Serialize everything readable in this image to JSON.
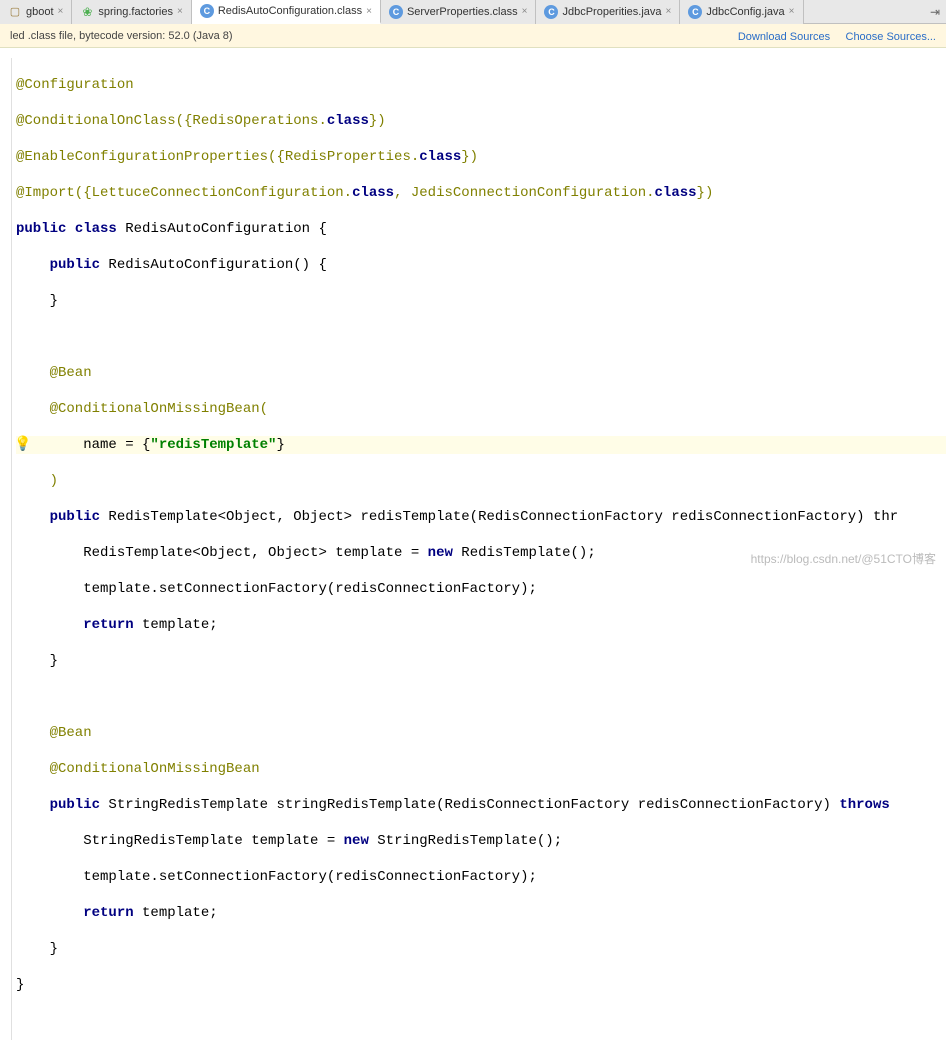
{
  "tabs": [
    {
      "label": "gboot",
      "type": "box"
    },
    {
      "label": "spring.factories",
      "type": "leaf"
    },
    {
      "label": "RedisAutoConfiguration.class",
      "type": "c",
      "active": true
    },
    {
      "label": "ServerProperties.class",
      "type": "c"
    },
    {
      "label": "JdbcProperities.java",
      "type": "c"
    },
    {
      "label": "JdbcConfig.java",
      "type": "c"
    }
  ],
  "info_bar": {
    "text": "led .class file, bytecode version: 52.0 (Java 8)",
    "download": "Download Sources",
    "choose": "Choose Sources..."
  },
  "code": {
    "l1": "@Configuration",
    "l2_a": "@ConditionalOnClass({RedisOperations.",
    "l2_b": "class",
    "l2_c": "})",
    "l3_a": "@EnableConfigurationProperties({RedisProperties.",
    "l3_b": "class",
    "l3_c": "})",
    "l4_a": "@Import({LettuceConnectionConfiguration.",
    "l4_b": "class",
    "l4_c": ", JedisConnectionConfiguration.",
    "l4_d": "class",
    "l4_e": "})",
    "l5_a": "public",
    "l5_b": " class",
    "l5_c": " RedisAutoConfiguration {",
    "l6_a": "    public",
    "l6_b": " RedisAutoConfiguration() {",
    "l7": "    }",
    "l8": "    @Bean",
    "l9": "    @ConditionalOnMissingBean(",
    "l10_a": "        name = {",
    "l10_b": "\"redisTemplate\"",
    "l10_c": "}",
    "l11": "    )",
    "l12_a": "    public",
    "l12_b": " RedisTemplate<Object, Object> redisTemplate(RedisConnectionFactory redisConnectionFactory) thr",
    "l13_a": "        RedisTemplate<Object, Object> template = ",
    "l13_b": "new",
    "l13_c": " RedisTemplate();",
    "l14": "        template.setConnectionFactory(redisConnectionFactory);",
    "l15_a": "        return",
    "l15_b": " template;",
    "l16": "    }",
    "l17": "    @Bean",
    "l18": "    @ConditionalOnMissingBean",
    "l19_a": "    public",
    "l19_b": " StringRedisTemplate stringRedisTemplate(RedisConnectionFactory redisConnectionFactory) ",
    "l19_c": "throws",
    "l20_a": "        StringRedisTemplate template = ",
    "l20_b": "new",
    "l20_c": " StringRedisTemplate();",
    "l21": "        template.setConnectionFactory(redisConnectionFactory);",
    "l22_a": "        return",
    "l22_b": " template;",
    "l23": "    }",
    "l24": "}"
  },
  "watermark": "https://blog.csdn.net/@51CTO博客",
  "bulb": "💡"
}
